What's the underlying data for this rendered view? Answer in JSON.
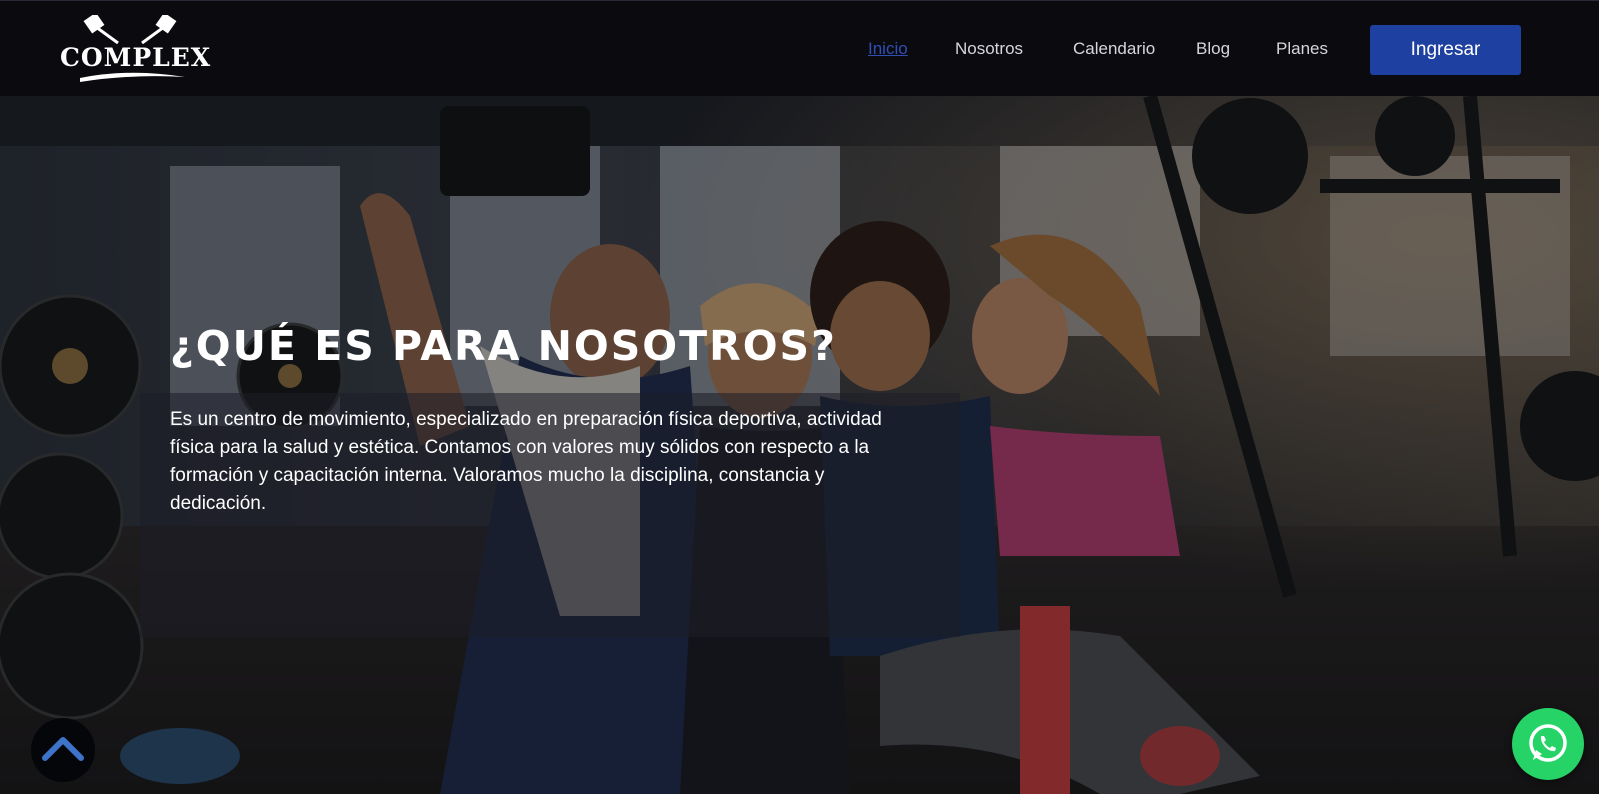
{
  "brand": {
    "name": "COMPLEX",
    "logo_icon": "crossed-dumbbells-icon"
  },
  "nav": {
    "items": [
      {
        "label": "Inicio",
        "active": true
      },
      {
        "label": "Nosotros",
        "active": false
      },
      {
        "label": "Calendario",
        "active": false
      },
      {
        "label": "Blog",
        "active": false
      },
      {
        "label": "Planes",
        "active": false
      }
    ],
    "login_label": "Ingresar"
  },
  "hero": {
    "title": "¿QUÉ ES PARA NOSOTROS?",
    "body": "Es un centro de movimiento, especializado en preparación física deportiva, actividad física para la salud y estética. Contamos con valores muy sólidos con respecto a la formación y capacitación interna. Valoramos mucho la disciplina, constancia y dedicación.",
    "background_image": "group-gym-selfie-photo"
  },
  "floating": {
    "scroll_top_icon": "chevron-up-icon",
    "whatsapp_icon": "whatsapp-icon"
  },
  "colors": {
    "navbar_bg": "#0a0a0f",
    "accent": "#1e40a0",
    "active_link": "#2f4fb5",
    "whatsapp": "#25d366"
  }
}
